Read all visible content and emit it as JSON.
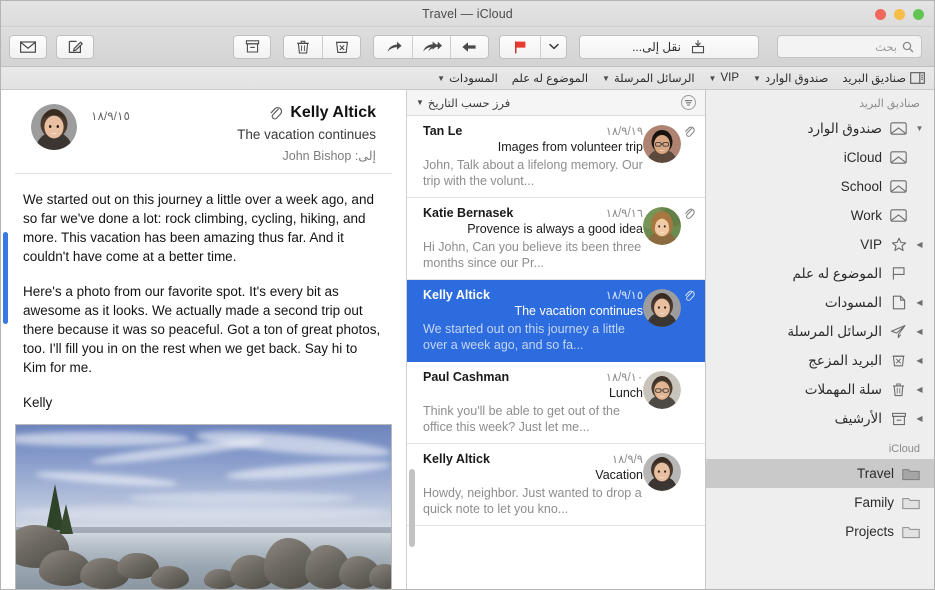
{
  "window": {
    "title": "Travel — iCloud",
    "traffic_lights": [
      "green",
      "yellow",
      "red"
    ]
  },
  "toolbar": {
    "search_placeholder": "بحث",
    "search_value": "",
    "move_to_label": "نقل إلى...",
    "buttons": [
      {
        "name": "flag-dropdown",
        "label": "",
        "icon": "chevron-down-icon"
      },
      {
        "name": "flag",
        "label": "",
        "icon": "flag-icon"
      },
      {
        "name": "reply",
        "label": "",
        "icon": "reply-icon"
      },
      {
        "name": "reply-all",
        "label": "",
        "icon": "reply-all-icon"
      },
      {
        "name": "forward",
        "label": "",
        "icon": "forward-icon"
      },
      {
        "name": "junk",
        "label": "",
        "icon": "junk-icon"
      },
      {
        "name": "delete",
        "label": "",
        "icon": "trash-icon"
      },
      {
        "name": "archive",
        "label": "",
        "icon": "archive-icon"
      },
      {
        "name": "compose",
        "label": "",
        "icon": "compose-icon"
      },
      {
        "name": "get-mail",
        "label": "",
        "icon": "envelope-icon"
      }
    ]
  },
  "favorites_bar": {
    "items": [
      {
        "label": "صناديق البريد",
        "icon": "sidebar-toggle-icon",
        "has_chevron": false
      },
      {
        "label": "صندوق الوارد",
        "icon": "",
        "has_chevron": true
      },
      {
        "label": "VIP",
        "icon": "",
        "has_chevron": true
      },
      {
        "label": "الرسائل المرسلة",
        "icon": "",
        "has_chevron": true
      },
      {
        "label": "الموضوع له علم",
        "icon": "",
        "has_chevron": false
      },
      {
        "label": "المسودات",
        "icon": "",
        "has_chevron": true
      }
    ]
  },
  "sidebar": {
    "section_mailboxes": "صناديق البريد",
    "section_icloud": "iCloud",
    "items": [
      {
        "label": "صندوق الوارد",
        "icon": "inbox-icon",
        "disclosure": "▼",
        "selected": false,
        "indent": 0
      },
      {
        "label": "iCloud",
        "icon": "inbox-icon",
        "disclosure": "",
        "selected": false,
        "indent": 1
      },
      {
        "label": "School",
        "icon": "inbox-icon",
        "disclosure": "",
        "selected": false,
        "indent": 1
      },
      {
        "label": "Work",
        "icon": "inbox-icon",
        "disclosure": "",
        "selected": false,
        "indent": 1
      },
      {
        "label": "VIP",
        "icon": "star-icon",
        "disclosure": "◀",
        "selected": false,
        "indent": 0
      },
      {
        "label": "الموضوع له علم",
        "icon": "flag-outline-icon",
        "disclosure": "",
        "selected": false,
        "indent": 0
      },
      {
        "label": "المسودات",
        "icon": "drafts-icon",
        "disclosure": "◀",
        "selected": false,
        "indent": 0
      },
      {
        "label": "الرسائل المرسلة",
        "icon": "sent-icon",
        "disclosure": "◀",
        "selected": false,
        "indent": 0
      },
      {
        "label": "البريد المزعج",
        "icon": "junk-icon",
        "disclosure": "◀",
        "selected": false,
        "indent": 0
      },
      {
        "label": "سلة المهملات",
        "icon": "trash-icon",
        "disclosure": "◀",
        "selected": false,
        "indent": 0
      },
      {
        "label": "الأرشيف",
        "icon": "archive-icon",
        "disclosure": "◀",
        "selected": false,
        "indent": 0
      }
    ],
    "icloud_items": [
      {
        "label": "Travel",
        "icon": "folder-icon",
        "selected": true
      },
      {
        "label": "Family",
        "icon": "folder-icon",
        "selected": false
      },
      {
        "label": "Projects",
        "icon": "folder-icon",
        "selected": false
      }
    ]
  },
  "message_list": {
    "sort_label": "فرز حسب التاريخ",
    "filter_icon": "filter-icon",
    "messages": [
      {
        "date": "١٨/٩/١٩",
        "sender": "Tan Le",
        "subject": "Images from volunteer trip",
        "preview": "John, Talk about a lifelong memory. Our trip with the volunt...",
        "has_attachment": true,
        "selected": false,
        "avatar": "tan-le"
      },
      {
        "date": "١٨/٩/١٦",
        "sender": "Katie Bernasek",
        "subject": "Provence is always a good idea",
        "preview": "Hi John, Can you believe its been three months since our Pr...",
        "has_attachment": true,
        "selected": false,
        "avatar": "katie-bernasek"
      },
      {
        "date": "١٨/٩/١٥",
        "sender": "Kelly Altick",
        "subject": "The vacation continues",
        "preview": "We started out on this journey a little over a week ago, and so fa...",
        "has_attachment": true,
        "selected": true,
        "avatar": "kelly-altick"
      },
      {
        "date": "١٨/٩/١٠",
        "sender": "Paul Cashman",
        "subject": "Lunch",
        "preview": "Think you'll be able to get out of the office this week? Just let me...",
        "has_attachment": false,
        "selected": false,
        "avatar": "paul-cashman"
      },
      {
        "date": "١٨/٩/٩",
        "sender": "Kelly Altick",
        "subject": "Vacation",
        "preview": "Howdy, neighbor. Just wanted to drop a quick note to let you kno...",
        "has_attachment": false,
        "selected": false,
        "avatar": "kelly-altick"
      }
    ]
  },
  "reader": {
    "date": "١٨/٩/١٥",
    "sender": "Kelly Altick",
    "subject": "The vacation continues",
    "to_label": "إلى:",
    "to_name": "John Bishop",
    "has_attachment": true,
    "body_paragraphs": [
      "We started out on this journey a little over a week ago, and so far we've done a lot: rock climbing, cycling, hiking, and more. This vacation has been amazing thus far. And it couldn't have come at a better time.",
      "Here's a photo from our favorite spot. It's every bit as awesome as it looks. We actually made a second trip out there because it was so peaceful. Got a ton of great photos, too. I'll fill you in on the rest when we get back. Say hi to Kim for me.",
      "Kelly"
    ],
    "attachment_image": "lake-shore-rocks-photo"
  },
  "colors": {
    "selection_blue": "#2d6cdf",
    "sidebar_bg": "#eeeeee",
    "sidebar_selected": "#c9c9c9",
    "toolbar_bg": "#d8d8d8",
    "flag_red": "#e8392f"
  }
}
